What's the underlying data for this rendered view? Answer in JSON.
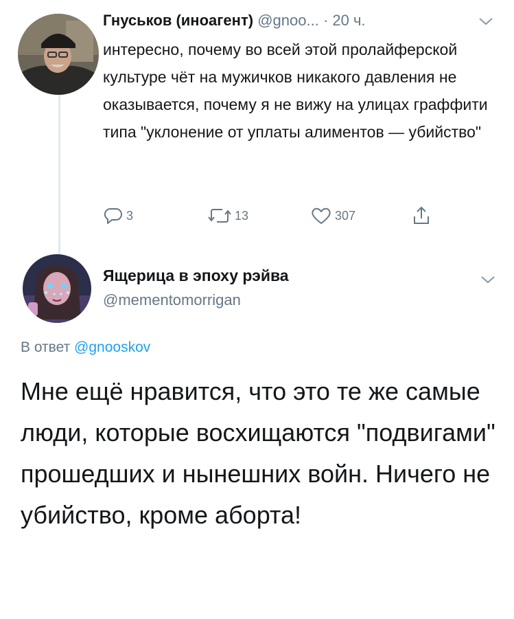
{
  "tweet1": {
    "display_name": "Гнуськов (иноагент)",
    "handle": "@gnoo...",
    "time": "· 20 ч.",
    "text": "интересно, почему во всей этой пролайферской культуре чёт на мужичков никакого давления не оказывается, почему я не вижу на улицах граффити типа \"уклонение от уплаты алиментов — убийство\"",
    "replies": "3",
    "retweets": "13",
    "likes": "307"
  },
  "tweet2": {
    "display_name": "Ящерица в эпоху рэйва",
    "handle": "@mementomorrigan",
    "reply_prefix": "В ответ",
    "reply_to": "@gnooskov",
    "text": "Мне ещё нравится, что это те же самые люди, которые восхищаются \"подвигами\" прошедших и нынешних войн. Ничего не убийство, кроме аборта!"
  },
  "icons": {
    "reply": "reply-icon",
    "retweet": "retweet-icon",
    "like": "heart-icon",
    "share": "share-icon",
    "menu": "chevron-down-icon"
  },
  "colors": {
    "text": "#14171a",
    "muted": "#657786",
    "link": "#1da1f2",
    "thread_line": "#e1e8ed"
  }
}
